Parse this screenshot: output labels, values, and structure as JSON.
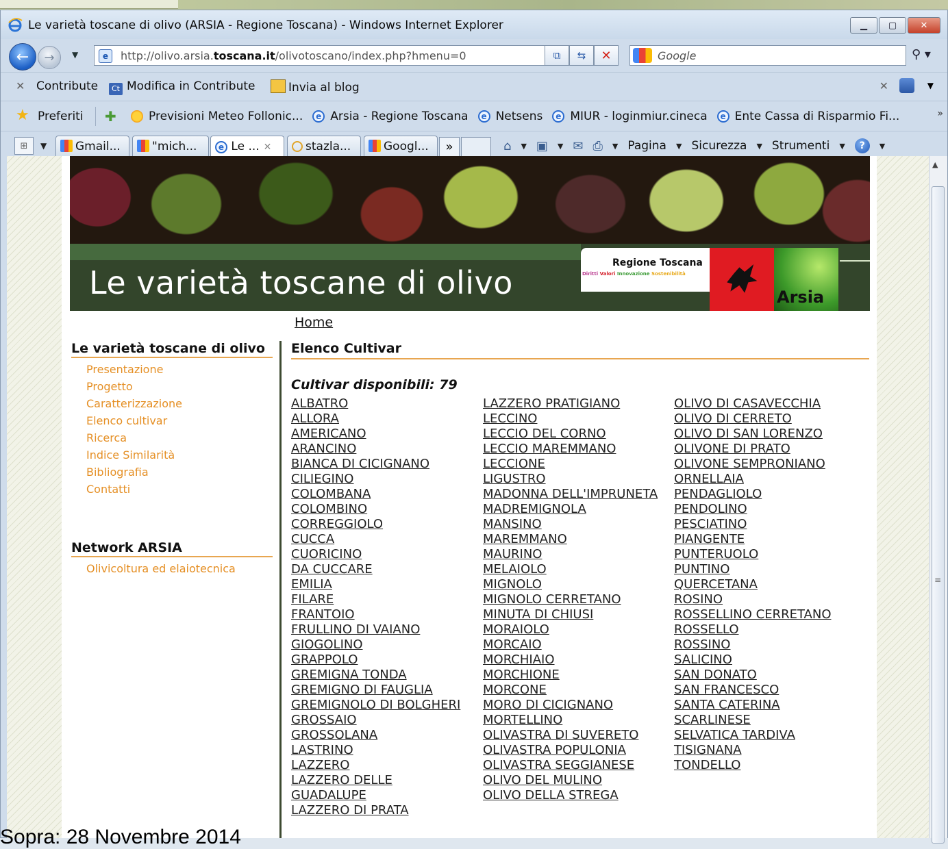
{
  "browser": {
    "window_title": "Le varietà toscane di olivo (ARSIA - Regione Toscana) - Windows Internet Explorer",
    "url_prefix": "http://olivo.arsia.",
    "url_domain": "toscana.it",
    "url_suffix": "/olivotoscano/index.php?hmenu=0",
    "search_placeholder": "Google",
    "contribute": {
      "contribute_label": "Contribute",
      "modifica_label": "Modifica in Contribute",
      "blog_label": "Invia al blog",
      "ct_badge": "Ct"
    },
    "favorites": {
      "label": "Preferiti",
      "links": [
        {
          "label": "Previsioni Meteo Follonic...",
          "icon": "sun-icon"
        },
        {
          "label": "Arsia - Regione Toscana",
          "icon": "ie-icon"
        },
        {
          "label": "Netsens",
          "icon": "ie-icon"
        },
        {
          "label": "MIUR - loginmiur.cineca",
          "icon": "ie-icon"
        },
        {
          "label": "Ente Cassa di Risparmio Fi...",
          "icon": "ie-icon"
        }
      ]
    },
    "tabs": [
      {
        "label": "Gmail...",
        "icon": "google-icon"
      },
      {
        "label": "\"mich...",
        "icon": "google-icon"
      },
      {
        "label": "Le ...",
        "icon": "ie-icon",
        "active": true
      },
      {
        "label": "stazla...",
        "icon": "loading-icon"
      },
      {
        "label": "Googl...",
        "icon": "google-icon"
      }
    ],
    "tab_more": "»",
    "commands": {
      "pagina": "Pagina",
      "sicurezza": "Sicurezza",
      "strumenti": "Strumenti"
    }
  },
  "site": {
    "banner_title": "Le varietà toscane di olivo",
    "regione_label": "Regione Toscana",
    "regione_slogan": [
      "Diritti",
      "Valori",
      "Innovazione",
      "Sostenibilità"
    ],
    "arsia_label": "Arsia",
    "breadcrumb_home": "Home",
    "sidebar": {
      "section_title": "Le varietà toscane di olivo",
      "items": [
        "Presentazione",
        "Progetto",
        "Caratterizzazione",
        "Elenco cultivar",
        "Ricerca",
        "Indice Similarità",
        "Bibliografia",
        "Contatti"
      ],
      "network_title": "Network ARSIA",
      "network_items": [
        "Olivicoltura ed elaiotecnica"
      ]
    },
    "main": {
      "title": "Elenco Cultivar",
      "count_label": "Cultivar disponibili: 79",
      "col1": [
        "ALBATRO",
        "ALLORA",
        "AMERICANO",
        "ARANCINO",
        "BIANCA DI CICIGNANO",
        "CILIEGINO",
        "COLOMBANA",
        "COLOMBINO",
        "CORREGGIOLO",
        "CUCCA",
        "CUORICINO",
        "DA CUCCARE",
        "EMILIA",
        "FILARE",
        "FRANTOIO",
        "FRULLINO DI VAIANO",
        "GIOGOLINO",
        "GRAPPOLO",
        "GREMIGNA TONDA",
        "GREMIGNO DI FAUGLIA",
        "GREMIGNOLO DI BOLGHERI",
        "GROSSAIO",
        "GROSSOLANA",
        "LASTRINO",
        "LAZZERO",
        "LAZZERO DELLE",
        "GUADALUPE",
        "LAZZERO DI PRATA"
      ],
      "col2": [
        "LAZZERO PRATIGIANO",
        "LECCINO",
        "LECCIO DEL CORNO",
        "LECCIO MAREMMANO",
        "LECCIONE",
        "LIGUSTRO",
        "MADONNA DELL'IMPRUNETA",
        "MADREMIGNOLA",
        "MANSINO",
        "MAREMMANO",
        "MAURINO",
        "MELAIOLO",
        "MIGNOLO",
        "MIGNOLO CERRETANO",
        "MINUTA DI CHIUSI",
        "MORAIOLO",
        "MORCAIO",
        "MORCHIAIO",
        "MORCHIONE",
        "MORCONE",
        "MORO DI CICIGNANO",
        "MORTELLINO",
        "OLIVASTRA DI SUVERETO",
        "OLIVASTRA POPULONIA",
        "OLIVASTRA SEGGIANESE",
        "OLIVO DEL MULINO",
        "OLIVO DELLA STREGA"
      ],
      "col3": [
        "OLIVO DI CASAVECCHIA",
        "OLIVO DI CERRETO",
        "OLIVO DI SAN LORENZO",
        "OLIVONE DI PRATO",
        "OLIVONE SEMPRONIANO",
        "ORNELLAIA",
        "PENDAGLIOLO",
        "PENDOLINO",
        "PESCIATINO",
        "PIANGENTE",
        "PUNTERUOLO",
        "PUNTINO",
        "QUERCETANA",
        "ROSINO",
        "ROSSELLINO CERRETANO",
        "ROSSELLO",
        "ROSSINO",
        "SALICINO",
        "SAN DONATO",
        "SAN FRANCESCO",
        "SANTA CATERINA",
        "SCARLINESE",
        "SELVATICA TARDIVA",
        "TISIGNANA",
        "TONDELLO"
      ]
    }
  },
  "overlay_text": "Sopra: 28 Novembre 2014"
}
